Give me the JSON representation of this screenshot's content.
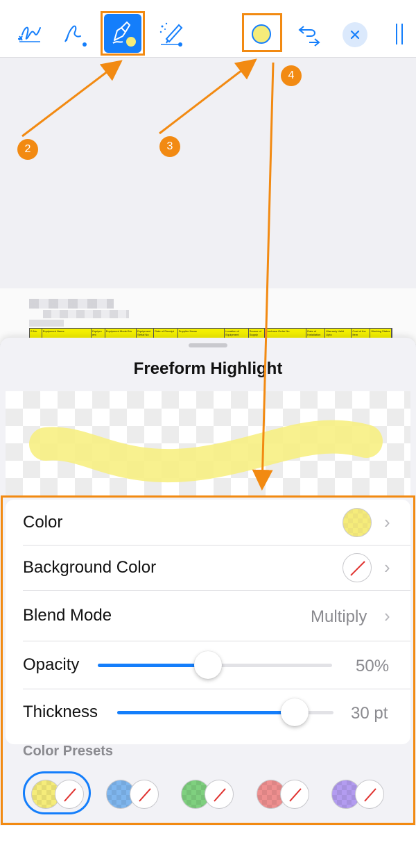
{
  "sheet": {
    "title": "Freeform Highlight"
  },
  "document": {
    "table_headers": [
      "S.No.",
      "Equipment Name",
      "Equipm ent",
      "Equipment Model No",
      "Equipment Serial No",
      "Date of Receipt",
      "Supplier Name",
      "Location of Equipment",
      "Source of Supply",
      "Purchase Order No",
      "Date of Installation",
      "Warranty Valid Upto",
      "Cost of the Item",
      "Working Status"
    ]
  },
  "settings": {
    "color_label": "Color",
    "color_value_hex": "#f5ec7a",
    "background_color_label": "Background Color",
    "blend_mode_label": "Blend Mode",
    "blend_mode_value": "Multiply",
    "opacity_label": "Opacity",
    "opacity_value": "50%",
    "opacity_fraction": 0.47,
    "thickness_label": "Thickness",
    "thickness_value": "30 pt",
    "thickness_fraction": 0.82,
    "presets_label": "Color Presets"
  },
  "presets": [
    {
      "color": "#f5ec7a",
      "selected": true
    },
    {
      "color": "#7fb6ee",
      "selected": false
    },
    {
      "color": "#7fd07f",
      "selected": false
    },
    {
      "color": "#ee8f8f",
      "selected": false
    },
    {
      "color": "#b39cf0",
      "selected": false
    }
  ],
  "annotations": {
    "badge_2": "2",
    "badge_3": "3",
    "badge_4": "4",
    "accent_color": "#f28a12"
  },
  "colors": {
    "accent_blue": "#147efb",
    "highlight_yellow": "#f5ec7a"
  },
  "toolbar": {
    "icons": [
      "signature-icon",
      "ink-pen-icon",
      "freeform-highlight-icon",
      "magic-ink-icon",
      "color-circle-icon",
      "undo-redo-icon",
      "close-icon",
      "more-icon"
    ]
  }
}
